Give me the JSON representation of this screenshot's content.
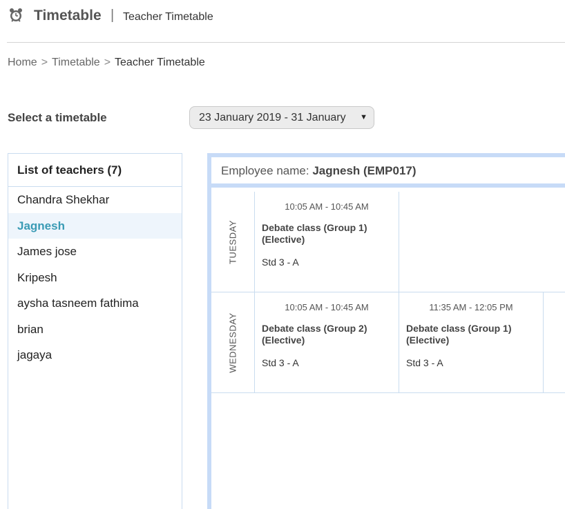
{
  "header": {
    "app_title": "Timetable",
    "separator": "|",
    "page_subtitle": "Teacher Timetable",
    "icon": "alarm-clock-icon"
  },
  "breadcrumb": {
    "items": [
      "Home",
      "Timetable",
      "Teacher Timetable"
    ],
    "separator": ">"
  },
  "selector": {
    "label": "Select a timetable",
    "value": "23 January 2019 - 31 January"
  },
  "teachers": {
    "title": "List of teachers (7)",
    "items": [
      "Chandra Shekhar",
      "Jagnesh",
      "James jose",
      "Kripesh",
      "aysha tasneem fathima",
      "brian",
      "jagaya"
    ],
    "active_index": 1
  },
  "timetable": {
    "employee_label": "Employee name:",
    "employee_name": "Jagnesh (EMP017)",
    "days": [
      {
        "day": "TUESDAY",
        "slots": [
          {
            "time": "10:05 AM - 10:45 AM",
            "subject": "Debate class (Group 1) (Elective)",
            "class": "Std 3 - A"
          }
        ]
      },
      {
        "day": "WEDNESDAY",
        "slots": [
          {
            "time": "10:05 AM - 10:45 AM",
            "subject": "Debate class (Group 2) (Elective)",
            "class": "Std 3 - A"
          },
          {
            "time": "11:35 AM - 12:05 PM",
            "subject": "Debate class (Group 1) (Elective)",
            "class": "Std 3 - A"
          }
        ]
      }
    ]
  },
  "colors": {
    "accent": "#3a9bb5",
    "panel_border": "#c7dbf7",
    "active_row_bg": "#eef5fc"
  }
}
